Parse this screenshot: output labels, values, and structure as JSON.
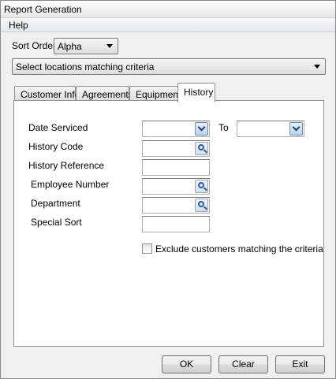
{
  "window": {
    "title": "Report Generation"
  },
  "menu": {
    "help": "Help"
  },
  "sort": {
    "label": "Sort Order",
    "value": "Alpha"
  },
  "location_filter": {
    "value": "Select locations matching criteria"
  },
  "tabs": [
    {
      "label": "Customer Info"
    },
    {
      "label": "Agreements"
    },
    {
      "label": "Equipment"
    },
    {
      "label": "History",
      "active": true
    }
  ],
  "history": {
    "date_serviced": {
      "label": "Date Serviced",
      "from": "",
      "to_label": "To",
      "to": ""
    },
    "history_code": {
      "label": "History Code",
      "value": ""
    },
    "history_reference": {
      "label": "History Reference",
      "value": ""
    },
    "employee_number": {
      "label": "Employee Number",
      "value": ""
    },
    "department": {
      "label": "Department",
      "value": ""
    },
    "special_sort": {
      "label": "Special Sort",
      "value": ""
    },
    "exclude": {
      "label": "Exclude customers matching the criteria",
      "checked": false
    }
  },
  "buttons": {
    "ok": "OK",
    "clear": "Clear",
    "exit": "Exit"
  }
}
